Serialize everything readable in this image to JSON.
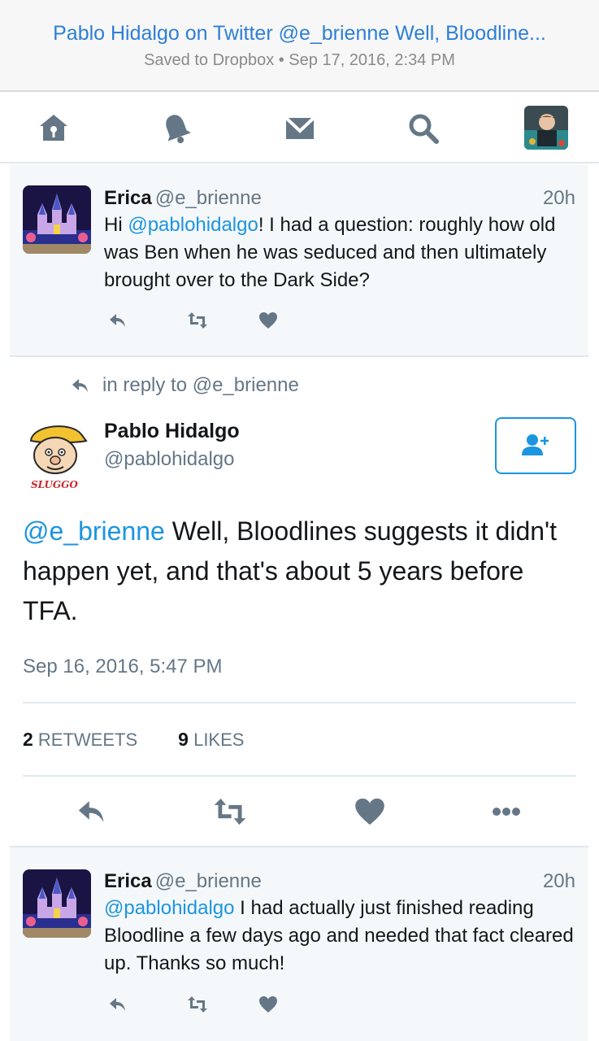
{
  "header": {
    "title": "Pablo Hidalgo on Twitter @e_brienne Well, Bloodline...",
    "subtitle": "Saved to Dropbox • Sep 17, 2016, 2:34 PM"
  },
  "nav": {
    "icons": [
      "home-icon",
      "notifications-icon",
      "messages-icon",
      "search-icon"
    ],
    "colors": {
      "icon": "#657786",
      "accent": "#1b95e0"
    }
  },
  "tweets": [
    {
      "name": "Erica",
      "handle": "@e_brienne",
      "time": "20h",
      "mention": "@pablohidalgo",
      "text_before": "Hi ",
      "text_after": "! I had a question: roughly how old was Ben when he was seduced and then ultimately brought over to the Dark Side?"
    },
    {
      "name": "Erica",
      "handle": "@e_brienne",
      "time": "20h",
      "mention": "@pablohidalgo",
      "text_before": "",
      "text_after": " I had actually just finished reading Bloodline a few days ago and needed that fact cleared up. Thanks so much!"
    }
  ],
  "main_tweet": {
    "in_reply_to": "in reply to @e_brienne",
    "name": "Pablo Hidalgo",
    "handle": "@pablohidalgo",
    "avatar_text": "SLUGGO",
    "mention": "@e_brienne",
    "text": " Well, Bloodlines suggests it didn't happen yet, and that's about 5 years before TFA.",
    "timestamp": "Sep 16, 2016, 5:47 PM",
    "retweets_count": "2",
    "retweets_label": "RETWEETS",
    "likes_count": "9",
    "likes_label": "LIKES"
  }
}
